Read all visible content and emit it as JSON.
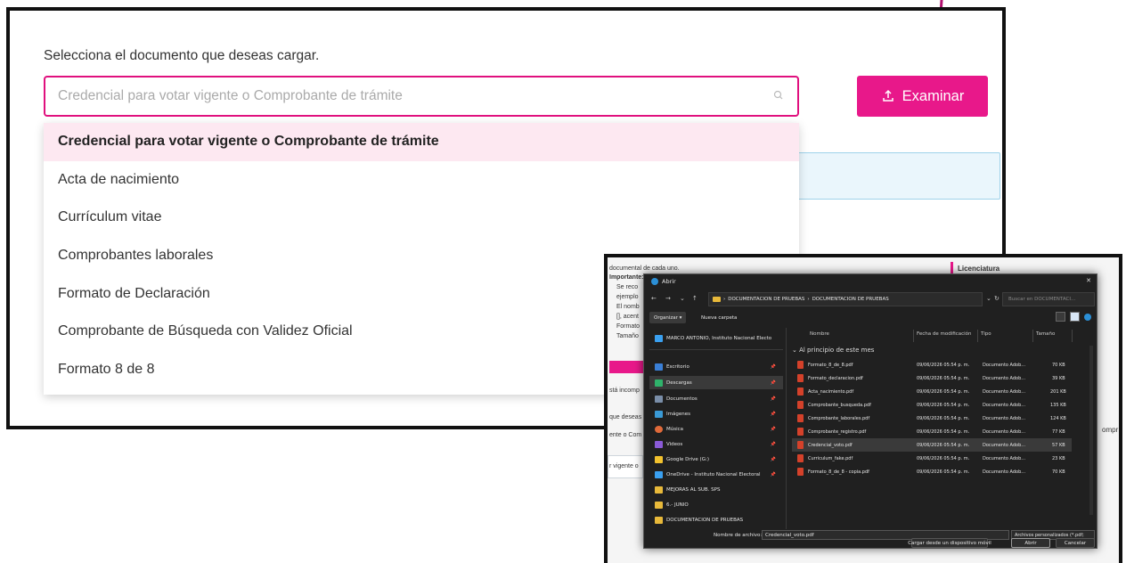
{
  "upload_form": {
    "label": "Selecciona el documento que deseas cargar.",
    "select_placeholder": "Credencial para votar vigente o Comprobante de trámite",
    "browse_label": "Examinar",
    "options": [
      "Credencial para votar vigente o Comprobante de trámite",
      "Acta de nacimiento",
      "Currículum vitae",
      "Comprobantes laborales",
      "Formato de Declaración",
      "Comprobante de Búsqueda con Validez Oficial",
      "Formato 8 de 8"
    ],
    "selected_index": 0
  },
  "background_page": {
    "texts": [
      "documental de cada uno.",
      "Importante:",
      "Se reco",
      "ejemplo",
      "El nomb",
      "[], acent",
      "Formato",
      "Tamaño",
      "stá incomp",
      "que deseas c",
      "ente o Com",
      "r vigente o",
      "Licenciatura",
      "ompr"
    ]
  },
  "file_dialog": {
    "title": "Abrir",
    "close": "✕",
    "path": [
      "DOCUMENTACION DE PRUEBAS",
      "DOCUMENTACION DE PRUEBAS"
    ],
    "search_placeholder": "Buscar en DOCUMENTACI...",
    "organize": "Organizar ▾",
    "new_folder": "Nueva carpeta",
    "sidebar": [
      {
        "label": "MARCO ANTONIO, Instituto Nacional Electo",
        "icon": "cloud-icon",
        "color": "#3aa0f0",
        "pinned": false
      },
      {
        "label": "Escritorio",
        "icon": "desktop-icon",
        "color": "#3a7fd6",
        "pinned": true
      },
      {
        "label": "Descargas",
        "icon": "download-icon",
        "color": "#2fb36b",
        "pinned": true
      },
      {
        "label": "Documentos",
        "icon": "documents-icon",
        "color": "#7a8ea8",
        "pinned": true
      },
      {
        "label": "Imágenes",
        "icon": "pictures-icon",
        "color": "#3a9ad6",
        "pinned": true
      },
      {
        "label": "Música",
        "icon": "music-icon",
        "color": "#e06a3a",
        "pinned": true
      },
      {
        "label": "Videos",
        "icon": "videos-icon",
        "color": "#8a5ad6",
        "pinned": true
      },
      {
        "label": "Google Drive (G:)",
        "icon": "google-drive-icon",
        "color": "#f2c22e",
        "pinned": true
      },
      {
        "label": "OneDrive - Instituto Nacional Electoral",
        "icon": "onedrive-icon",
        "color": "#3aa0f0",
        "pinned": true
      },
      {
        "label": "MEJORAS AL SUB. SPS",
        "icon": "folder-icon",
        "color": "#e8b93a",
        "pinned": false
      },
      {
        "label": "6.- JUNIO",
        "icon": "folder-icon",
        "color": "#e8b93a",
        "pinned": false
      },
      {
        "label": "DOCUMENTACION DE PRUEBAS",
        "icon": "folder-icon",
        "color": "#e8b93a",
        "pinned": false
      }
    ],
    "columns": {
      "name": "Nombre",
      "date": "Fecha de modificación",
      "type": "Tipo",
      "size": "Tamaño"
    },
    "group_label": "Al principio de este mes",
    "files": [
      {
        "name": "Formato_8_de_8.pdf",
        "date": "09/06/2026 05:54 p. m.",
        "type": "Documento Adob...",
        "size": "70 KB"
      },
      {
        "name": "Formato_declaracion.pdf",
        "date": "09/06/2026 05:54 p. m.",
        "type": "Documento Adob...",
        "size": "39 KB"
      },
      {
        "name": "Acta_nacimiento.pdf",
        "date": "09/06/2026 05:54 p. m.",
        "type": "Documento Adob...",
        "size": "201 KB"
      },
      {
        "name": "Comprobante_busqueda.pdf",
        "date": "09/06/2026 05:54 p. m.",
        "type": "Documento Adob...",
        "size": "135 KB"
      },
      {
        "name": "Comprobante_laborales.pdf",
        "date": "09/06/2026 05:54 p. m.",
        "type": "Documento Adob...",
        "size": "124 KB"
      },
      {
        "name": "Comprobante_registro.pdf",
        "date": "09/06/2026 05:54 p. m.",
        "type": "Documento Adob...",
        "size": "77 KB"
      },
      {
        "name": "Credencial_voto.pdf",
        "date": "09/06/2026 05:54 p. m.",
        "type": "Documento Adob...",
        "size": "57 KB"
      },
      {
        "name": "Curriculum_fake.pdf",
        "date": "09/06/2026 05:54 p. m.",
        "type": "Documento Adob...",
        "size": "23 KB"
      },
      {
        "name": "Formato_8_de_8 - copia.pdf",
        "date": "09/06/2026 05:54 p. m.",
        "type": "Documento Adob...",
        "size": "70 KB"
      }
    ],
    "selected_file_index": 6,
    "filename_label": "Nombre de archivo:",
    "filename_value": "Credencial_voto.pdf",
    "filetype_value": "Archivos personalizados (*.pdf;",
    "mobile_button": "Cargar desde un dispositivo móvil",
    "open_button": "Abrir",
    "cancel_button": "Cancelar"
  },
  "colors": {
    "accent_pink": "#e8188a",
    "select_border": "#e0107e",
    "selected_option_bg": "#fde8f1",
    "info_bg": "#eaf6fc",
    "dialog_bg": "#202020",
    "arrow": "#b0106e"
  }
}
